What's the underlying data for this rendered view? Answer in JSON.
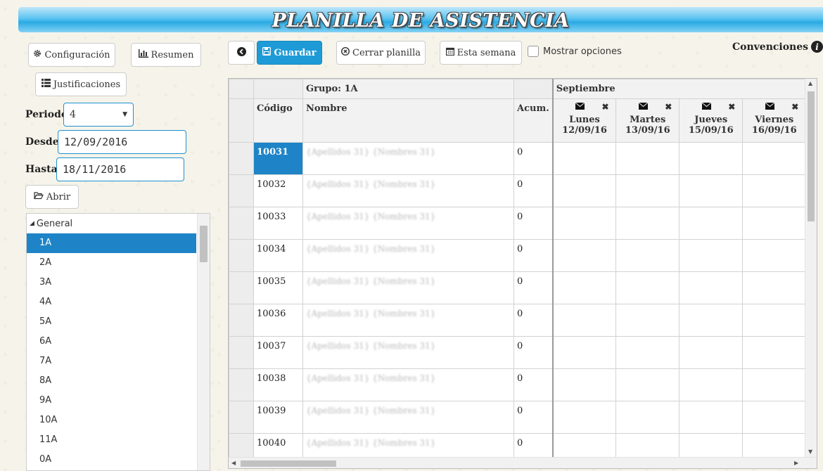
{
  "header": {
    "title": "PLANILLA DE ASISTENCIA"
  },
  "sidebar": {
    "config_label": "Configuración",
    "summary_label": "Resumen",
    "justif_label": "Justificaciones",
    "periodo_label": "Periodo",
    "periodo_value": "4",
    "desde_label": "Desde",
    "desde_value": "12/09/2016",
    "hasta_label": "Hasta",
    "hasta_value": "18/11/2016",
    "open_label": "Abrir",
    "tree_root": "General",
    "groups": [
      "1A",
      "2A",
      "3A",
      "4A",
      "5A",
      "6A",
      "7A",
      "8A",
      "9A",
      "10A",
      "11A",
      "0A"
    ],
    "selected_group": "1A"
  },
  "toolbar": {
    "back_label": "",
    "save_label": "Guardar",
    "close_label": "Cerrar planilla",
    "week_label": "Esta semana",
    "options_label": "Mostrar opciones",
    "conventions_label": "Convenciones"
  },
  "grid": {
    "group_header": "Grupo: 1A",
    "month_header": "Septiembre",
    "col_code": "Código",
    "col_name": "Nombre",
    "col_acum": "Acum.",
    "days": [
      {
        "name": "Lunes",
        "date": "12/09/16"
      },
      {
        "name": "Martes",
        "date": "13/09/16"
      },
      {
        "name": "Jueves",
        "date": "15/09/16"
      },
      {
        "name": "Viernes",
        "date": "16/09/16"
      }
    ],
    "rows": [
      {
        "code": "10031",
        "name": "{Apellidos 31} {Nombres 31}",
        "acum": "0"
      },
      {
        "code": "10032",
        "name": "{Apellidos 31} {Nombres 31}",
        "acum": "0"
      },
      {
        "code": "10033",
        "name": "{Apellidos 31} {Nombres 31}",
        "acum": "0"
      },
      {
        "code": "10034",
        "name": "{Apellidos 31} {Nombres 31}",
        "acum": "0"
      },
      {
        "code": "10035",
        "name": "{Apellidos 31} {Nombres 31}",
        "acum": "0"
      },
      {
        "code": "10036",
        "name": "{Apellidos 31} {Nombres 31}",
        "acum": "0"
      },
      {
        "code": "10037",
        "name": "{Apellidos 31} {Nombres 31}",
        "acum": "0"
      },
      {
        "code": "10038",
        "name": "{Apellidos 31} {Nombres 31}",
        "acum": "0"
      },
      {
        "code": "10039",
        "name": "{Apellidos 31} {Nombres 31}",
        "acum": "0"
      },
      {
        "code": "10040",
        "name": "{Apellidos 31} {Nombres 31}",
        "acum": "0"
      }
    ]
  },
  "icons": {
    "config": "gear-icon",
    "summary": "bar-chart-icon",
    "justif": "list-icon",
    "open": "folder-open-icon",
    "back": "arrow-left-circle-icon",
    "save": "floppy-disk-icon",
    "close": "x-circle-icon",
    "week": "calendar-icon",
    "info": "info-circle-icon",
    "mail": "envelope-icon",
    "remove": "times-icon"
  },
  "colors": {
    "accent": "#1e84c7",
    "primary_button": "#1e9bd7",
    "title_bar": "#2aaae4"
  }
}
